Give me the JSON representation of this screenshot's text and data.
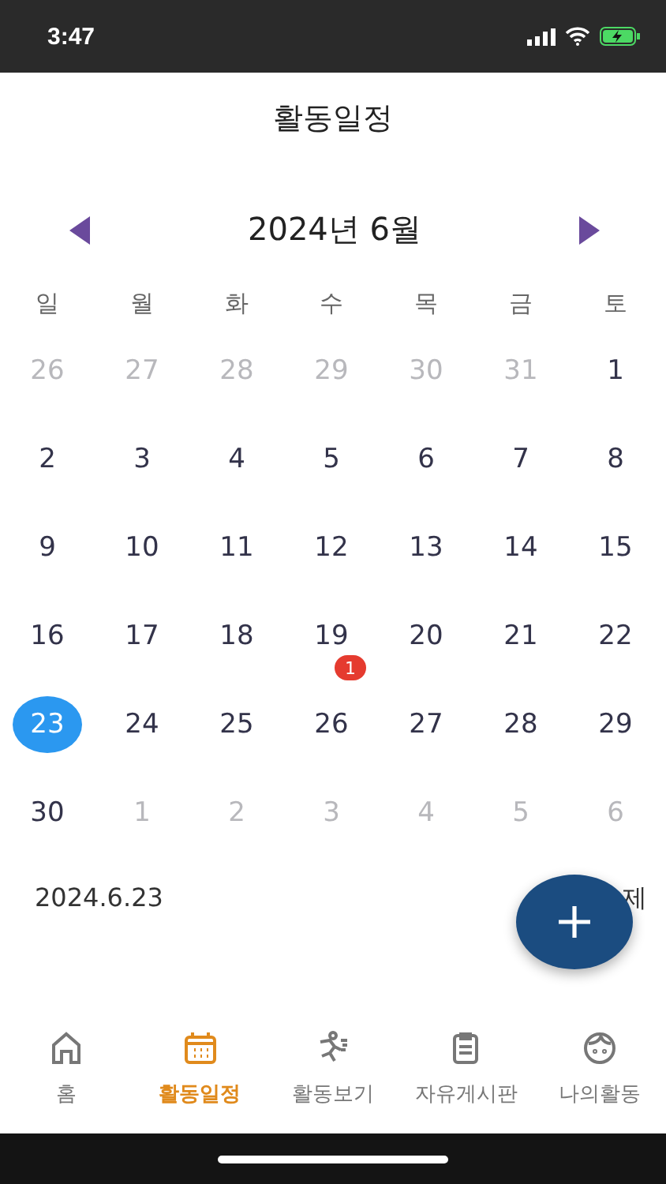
{
  "status_bar": {
    "time": "3:47"
  },
  "header": {
    "title": "활동일정"
  },
  "calendar": {
    "month_label": "2024년 6월",
    "weekdays": [
      "일",
      "월",
      "화",
      "수",
      "목",
      "금",
      "토"
    ],
    "weeks": [
      [
        {
          "day": "26",
          "muted": true,
          "selected": false
        },
        {
          "day": "27",
          "muted": true,
          "selected": false
        },
        {
          "day": "28",
          "muted": true,
          "selected": false
        },
        {
          "day": "29",
          "muted": true,
          "selected": false
        },
        {
          "day": "30",
          "muted": true,
          "selected": false
        },
        {
          "day": "31",
          "muted": true,
          "selected": false
        },
        {
          "day": "1",
          "muted": false,
          "selected": false
        }
      ],
      [
        {
          "day": "2",
          "muted": false,
          "selected": false
        },
        {
          "day": "3",
          "muted": false,
          "selected": false
        },
        {
          "day": "4",
          "muted": false,
          "selected": false
        },
        {
          "day": "5",
          "muted": false,
          "selected": false
        },
        {
          "day": "6",
          "muted": false,
          "selected": false
        },
        {
          "day": "7",
          "muted": false,
          "selected": false
        },
        {
          "day": "8",
          "muted": false,
          "selected": false
        }
      ],
      [
        {
          "day": "9",
          "muted": false,
          "selected": false
        },
        {
          "day": "10",
          "muted": false,
          "selected": false
        },
        {
          "day": "11",
          "muted": false,
          "selected": false
        },
        {
          "day": "12",
          "muted": false,
          "selected": false
        },
        {
          "day": "13",
          "muted": false,
          "selected": false
        },
        {
          "day": "14",
          "muted": false,
          "selected": false
        },
        {
          "day": "15",
          "muted": false,
          "selected": false
        }
      ],
      [
        {
          "day": "16",
          "muted": false,
          "selected": false
        },
        {
          "day": "17",
          "muted": false,
          "selected": false
        },
        {
          "day": "18",
          "muted": false,
          "selected": false
        },
        {
          "day": "19",
          "muted": false,
          "selected": false,
          "badge": "1"
        },
        {
          "day": "20",
          "muted": false,
          "selected": false
        },
        {
          "day": "21",
          "muted": false,
          "selected": false
        },
        {
          "day": "22",
          "muted": false,
          "selected": false
        }
      ],
      [
        {
          "day": "23",
          "muted": false,
          "selected": true
        },
        {
          "day": "24",
          "muted": false,
          "selected": false
        },
        {
          "day": "25",
          "muted": false,
          "selected": false
        },
        {
          "day": "26",
          "muted": false,
          "selected": false
        },
        {
          "day": "27",
          "muted": false,
          "selected": false
        },
        {
          "day": "28",
          "muted": false,
          "selected": false
        },
        {
          "day": "29",
          "muted": false,
          "selected": false
        }
      ],
      [
        {
          "day": "30",
          "muted": false,
          "selected": false
        },
        {
          "day": "1",
          "muted": true,
          "selected": false
        },
        {
          "day": "2",
          "muted": true,
          "selected": false
        },
        {
          "day": "3",
          "muted": true,
          "selected": false
        },
        {
          "day": "4",
          "muted": true,
          "selected": false
        },
        {
          "day": "5",
          "muted": true,
          "selected": false
        },
        {
          "day": "6",
          "muted": true,
          "selected": false
        }
      ]
    ]
  },
  "selected_date": {
    "date": "2024.6.23",
    "trailing": "제"
  },
  "tab_bar": [
    {
      "label": "홈",
      "kind": "home",
      "selected": false
    },
    {
      "label": "활동일정",
      "kind": "calendar",
      "selected": true
    },
    {
      "label": "활동보기",
      "kind": "runner",
      "selected": false
    },
    {
      "label": "자유게시판",
      "kind": "clipboard",
      "selected": false
    },
    {
      "label": "나의활동",
      "kind": "face",
      "selected": false
    }
  ]
}
